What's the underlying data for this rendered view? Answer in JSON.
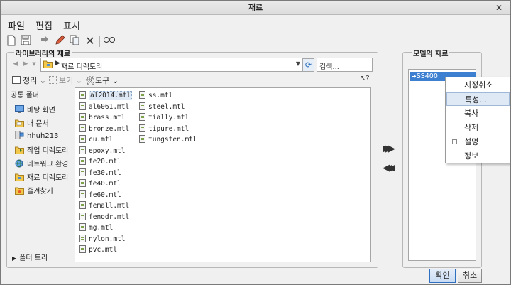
{
  "window": {
    "title": "재료"
  },
  "menubar": {
    "items": [
      "파일",
      "편집",
      "표시"
    ]
  },
  "library": {
    "group_title": "라이브러리의 재료",
    "path": "재료 디렉토리",
    "search_placeholder": "검색...",
    "options": {
      "organize": "정리",
      "view": "보기",
      "tools": "도구"
    }
  },
  "common_folders": {
    "title": "공통 폴더",
    "items": [
      {
        "label": "바탕 화면",
        "icon": "desktop-icon"
      },
      {
        "label": "내 문서",
        "icon": "documents-icon"
      },
      {
        "label": "hhuh213",
        "icon": "computer-icon"
      },
      {
        "label": "작업 디렉토리",
        "icon": "working-directory-icon"
      },
      {
        "label": "네트워크 환경",
        "icon": "network-icon"
      },
      {
        "label": "재료 디렉토리",
        "icon": "folder-icon"
      },
      {
        "label": "즐겨찾기",
        "icon": "favorites-icon"
      }
    ],
    "folder_tree": "폴더 트리"
  },
  "files": {
    "column1": [
      "al2014.mtl",
      "al6061.mtl",
      "brass.mtl",
      "bronze.mtl",
      "cu.mtl",
      "epoxy.mtl",
      "fe20.mtl",
      "fe30.mtl",
      "fe40.mtl",
      "fe60.mtl",
      "femall.mtl",
      "fenodr.mtl",
      "mg.mtl",
      "nylon.mtl",
      "pvc.mtl"
    ],
    "column2": [
      "ss.mtl",
      "steel.mtl",
      "tially.mtl",
      "tipure.mtl",
      "tungsten.mtl"
    ]
  },
  "model": {
    "group_title": "모델의 재료",
    "items": [
      "SS400"
    ]
  },
  "context_menu": {
    "items": [
      "지정취소",
      "특성...",
      "복사",
      "삭제",
      "설명",
      "정보"
    ]
  },
  "buttons": {
    "ok": "확인",
    "cancel": "취소"
  }
}
